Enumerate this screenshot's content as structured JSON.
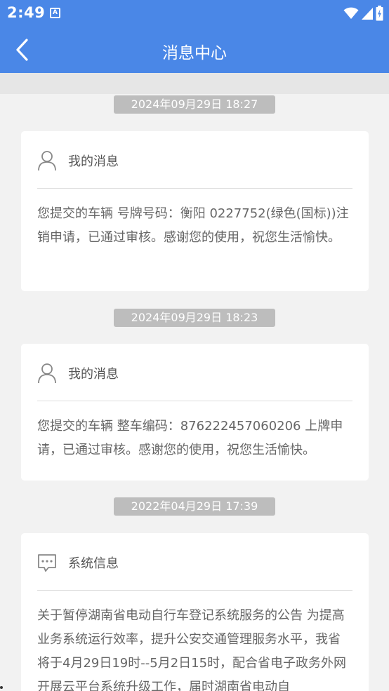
{
  "status_bar": {
    "time": "2:49",
    "notification_icon": "A"
  },
  "header": {
    "title": "消息中心",
    "back_icon": "chevron-left-icon"
  },
  "messages": [
    {
      "timestamp": "2024年09月29日 18:27",
      "category": "我的消息",
      "category_icon": "user-icon",
      "body": "您提交的车辆 号牌号码：衡阳 0227752(绿色(国标))注销申请，已通过审核。感谢您的使用，祝您生活愉快。"
    },
    {
      "timestamp": "2024年09月29日 18:23",
      "category": "我的消息",
      "category_icon": "user-icon",
      "body": "您提交的车辆 整车编码：876222457060206 上牌申请，已通过审核。感谢您的使用，祝您生活愉快。"
    },
    {
      "timestamp": "2022年04月29日 17:39",
      "category": "系统信息",
      "category_icon": "chat-icon",
      "body": "关于暂停湖南省电动自行车登记系统服务的公告 为提高业务系统运行效率，提升公安交通管理服务水平，我省将于4月29日19时--5月2日15时，配合省电子政务外网开展云平台系统升级工作，届时湖南省电动自"
    }
  ],
  "colors": {
    "primary": "#4a87e7",
    "background": "#f2f2f2",
    "timestamp_bg": "#bdbdbd"
  }
}
